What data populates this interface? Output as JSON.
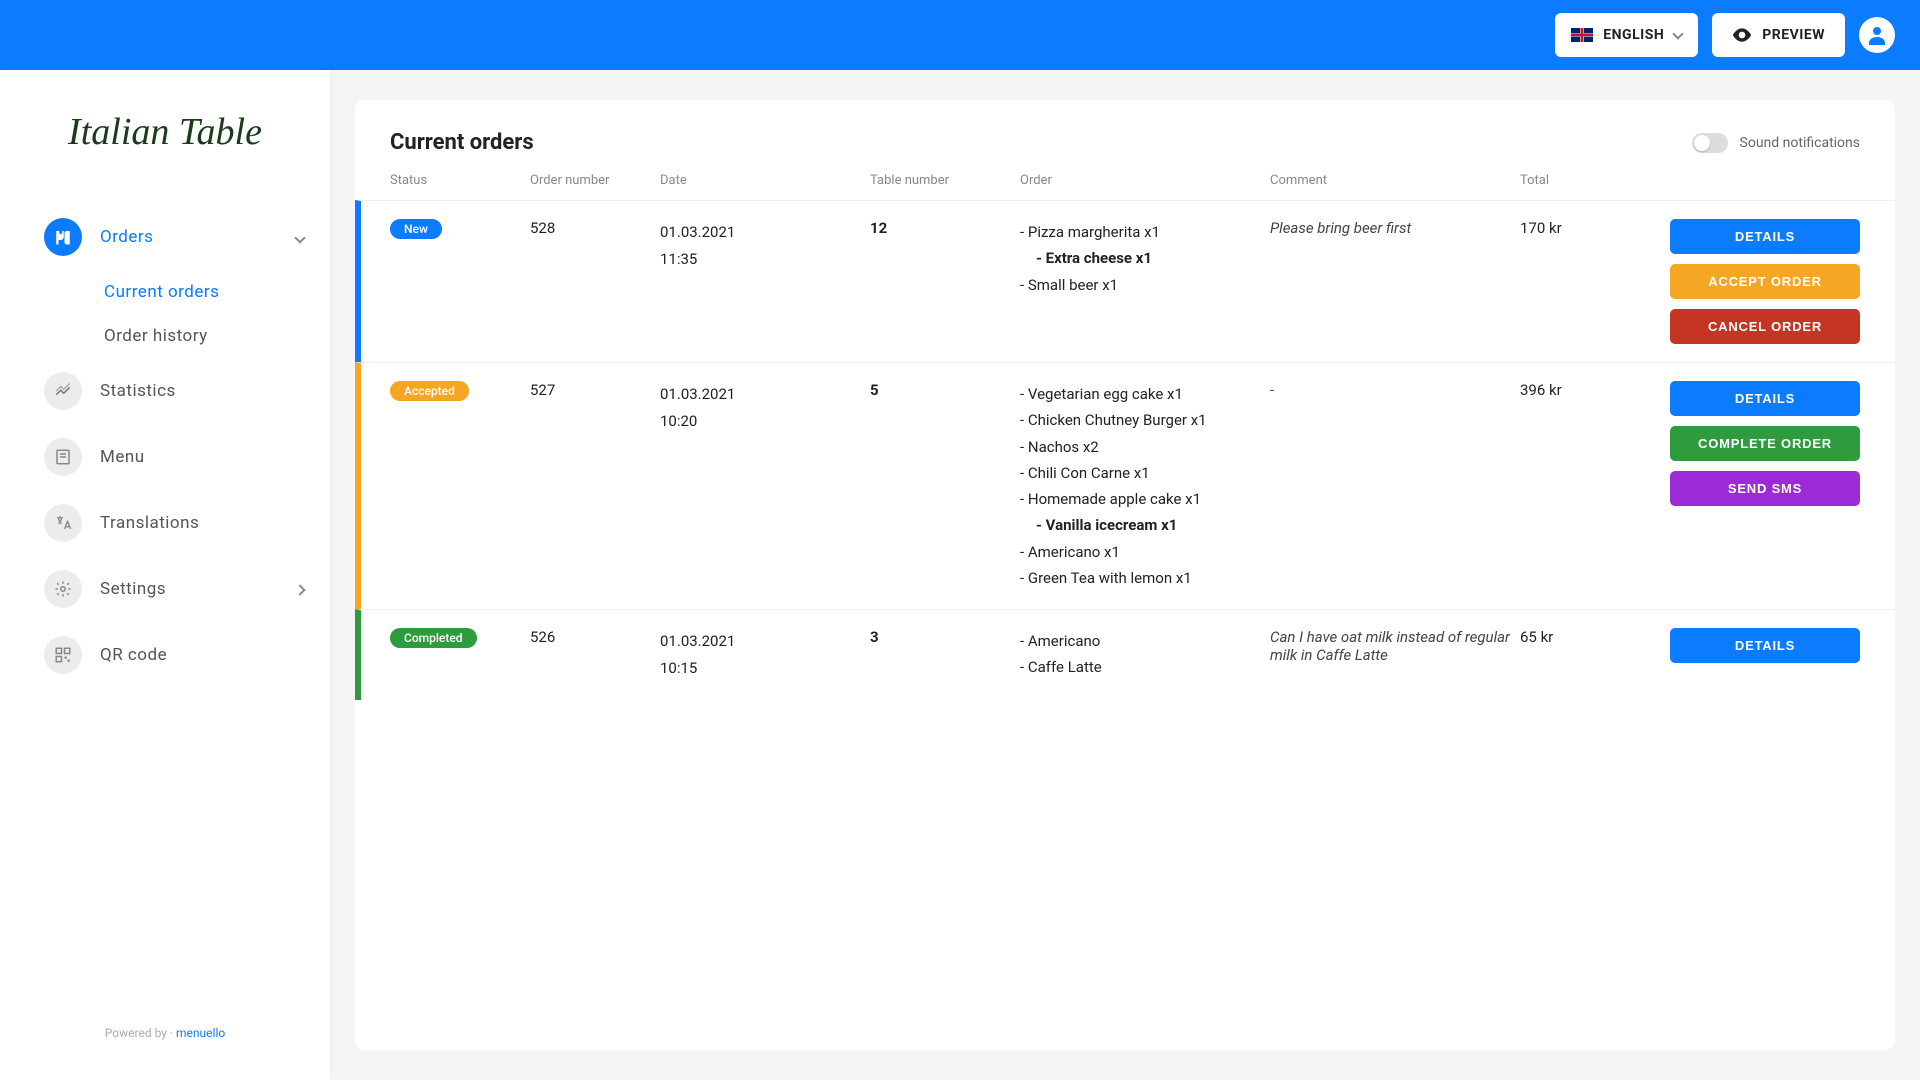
{
  "topbar": {
    "language": "ENGLISH",
    "preview": "PREVIEW"
  },
  "sidebar": {
    "logo": "Italian Table",
    "items": [
      {
        "label": "Orders",
        "active": true
      },
      {
        "label": "Statistics"
      },
      {
        "label": "Menu"
      },
      {
        "label": "Translations"
      },
      {
        "label": "Settings"
      },
      {
        "label": "QR code"
      }
    ],
    "subnav": {
      "current_orders": "Current orders",
      "order_history": "Order history"
    },
    "powered_by": "Powered by",
    "powered_link": "menuello"
  },
  "main": {
    "title": "Current orders",
    "sound_label": "Sound notifications",
    "columns": {
      "status": "Status",
      "order_number": "Order number",
      "date": "Date",
      "table_number": "Table number",
      "order": "Order",
      "comment": "Comment",
      "total": "Total"
    },
    "rows": [
      {
        "status_class": "new",
        "status_label": "New",
        "number": "528",
        "date": "01.03.2021",
        "time": "11:35",
        "table": "12",
        "order_items": [
          {
            "text": "- Pizza margherita x1"
          },
          {
            "text": "- Extra cheese x1",
            "sub": true
          },
          {
            "text": "- Small beer x1"
          }
        ],
        "comment": "Please bring beer first",
        "total": "170 kr",
        "actions": [
          {
            "label": "DETAILS",
            "class": "blue"
          },
          {
            "label": "ACCEPT ORDER",
            "class": "orange"
          },
          {
            "label": "CANCEL ORDER",
            "class": "red"
          }
        ]
      },
      {
        "status_class": "accepted",
        "status_label": "Accepted",
        "number": "527",
        "date": "01.03.2021",
        "time": "10:20",
        "table": "5",
        "order_items": [
          {
            "text": "- Vegetarian egg cake x1"
          },
          {
            "text": "- Chicken Chutney Burger x1"
          },
          {
            "text": "- Nachos x2"
          },
          {
            "text": "- Chili Con Carne x1"
          },
          {
            "text": "- Homemade apple cake x1"
          },
          {
            "text": "- Vanilla icecream  x1",
            "sub": true
          },
          {
            "text": "- Americano  x1"
          },
          {
            "text": "- Green Tea with lemon  x1"
          }
        ],
        "comment": "-",
        "total": "396 kr",
        "actions": [
          {
            "label": "DETAILS",
            "class": "blue"
          },
          {
            "label": "COMPLETE ORDER",
            "class": "green"
          },
          {
            "label": "SEND SMS",
            "class": "purple"
          }
        ]
      },
      {
        "status_class": "completed",
        "status_label": "Completed",
        "number": "526",
        "date": "01.03.2021",
        "time": "10:15",
        "table": "3",
        "order_items": [
          {
            "text": "- Americano"
          },
          {
            "text": "- Caffe Latte"
          }
        ],
        "comment": "Can I have oat milk instead of regular milk in Caffe Latte",
        "total": "65 kr",
        "actions": [
          {
            "label": "DETAILS",
            "class": "blue"
          }
        ]
      }
    ]
  }
}
